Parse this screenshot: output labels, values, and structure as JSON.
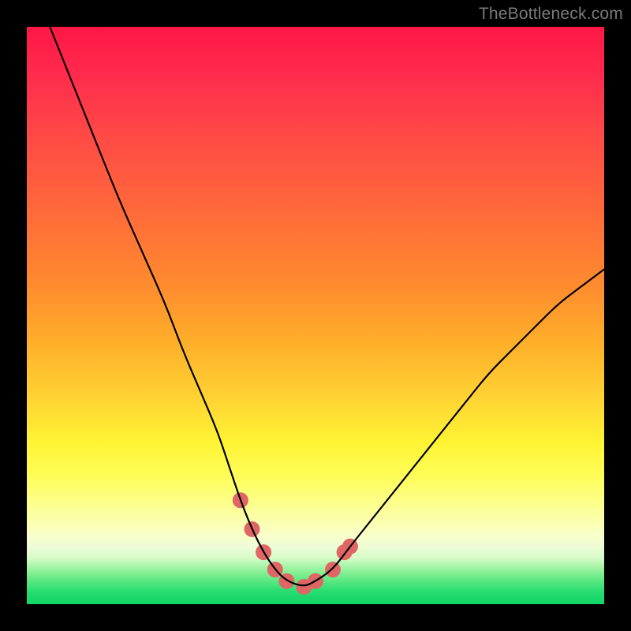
{
  "watermark": "TheBottleneck.com",
  "chart_data": {
    "type": "line",
    "title": "",
    "xlabel": "",
    "ylabel": "",
    "xlim": [
      0,
      100
    ],
    "ylim": [
      0,
      100
    ],
    "grid": false,
    "series": [
      {
        "name": "bottleneck-curve",
        "color": "#000000",
        "x": [
          4,
          8,
          12,
          16,
          20,
          24,
          27,
          30,
          33,
          35,
          37,
          39,
          41,
          43,
          45,
          48,
          50,
          53,
          56,
          60,
          64,
          68,
          72,
          76,
          80,
          84,
          88,
          92,
          96,
          100
        ],
        "values": [
          100,
          90,
          80,
          70,
          61,
          52,
          44,
          37,
          30,
          24,
          18,
          13,
          9,
          6,
          4,
          3,
          4,
          6,
          10,
          15,
          20,
          25,
          30,
          35,
          40,
          44,
          48,
          52,
          55,
          58
        ]
      }
    ],
    "markers": {
      "name": "highlighted-points",
      "color": "#e06666",
      "radius_px": 10,
      "points": [
        {
          "x": 37,
          "y": 18
        },
        {
          "x": 39,
          "y": 13
        },
        {
          "x": 41,
          "y": 9
        },
        {
          "x": 43,
          "y": 6
        },
        {
          "x": 45,
          "y": 4
        },
        {
          "x": 48,
          "y": 3
        },
        {
          "x": 50,
          "y": 4
        },
        {
          "x": 53,
          "y": 6
        },
        {
          "x": 55,
          "y": 9
        },
        {
          "x": 56,
          "y": 10
        }
      ]
    },
    "background_gradient": {
      "top": "#ff1744",
      "mid_upper": "#ff8c2e",
      "mid": "#fff433",
      "mid_lower": "#f8ffc8",
      "bottom": "#14d767"
    }
  }
}
